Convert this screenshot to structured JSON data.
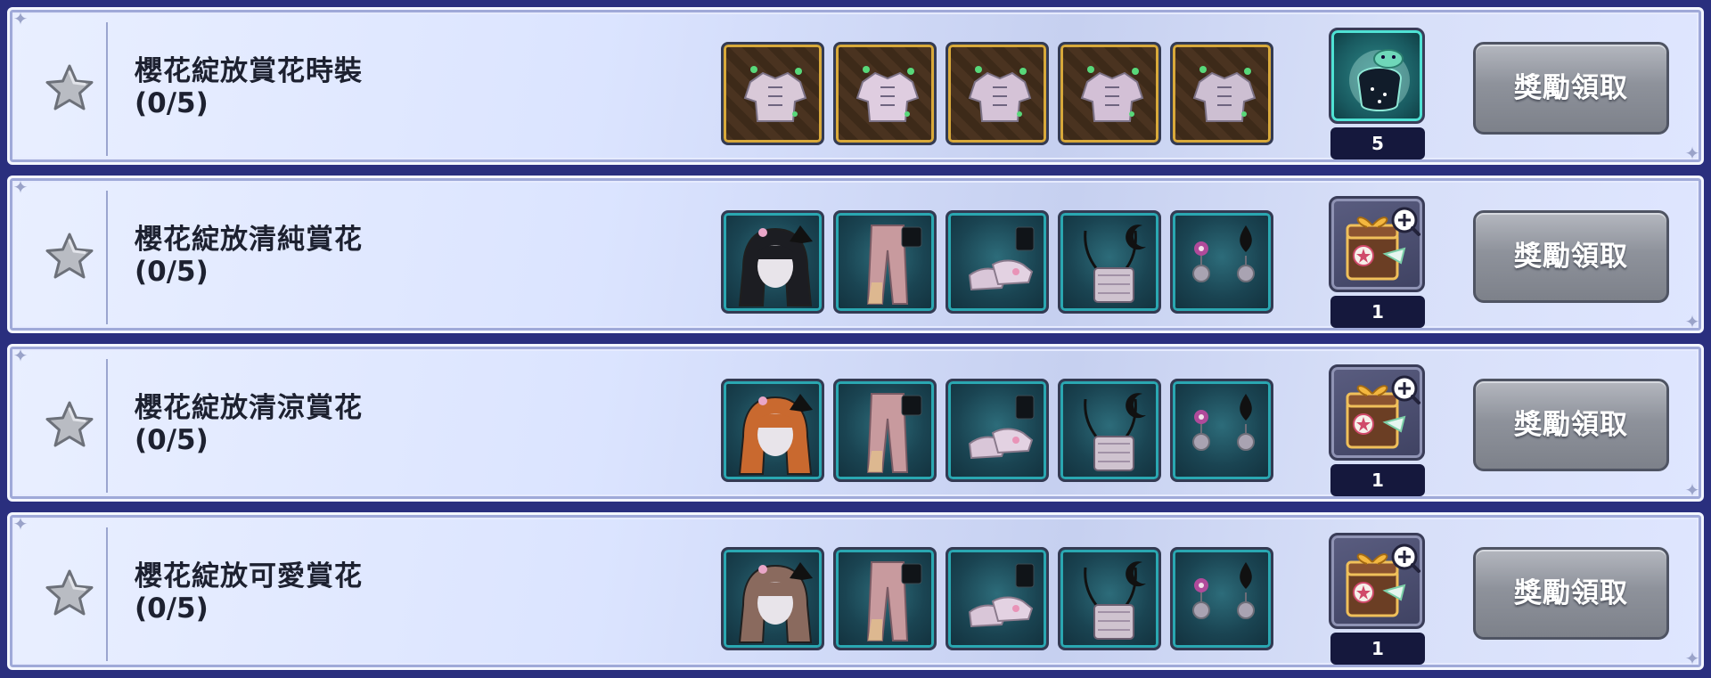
{
  "rows": [
    {
      "title": "櫻花綻放賞花時裝",
      "progress": "(0/5)",
      "items": [
        "top-outfit-1-icon",
        "top-outfit-2-icon",
        "top-outfit-3-icon",
        "top-outfit-4-icon",
        "top-outfit-5-icon"
      ],
      "item_style": "gold",
      "reward_icon": "teal-pouch-icon",
      "reward_count": "5",
      "claim_label": "獎勵領取"
    },
    {
      "title": "櫻花綻放清純賞花",
      "progress": "(0/5)",
      "items": [
        "black-hair-icon",
        "pants-icon",
        "shoes-icon",
        "handbag-icon",
        "earrings-icon"
      ],
      "item_style": "teal",
      "reward_icon": "gift-box-icon",
      "reward_count": "1",
      "claim_label": "獎勵領取"
    },
    {
      "title": "櫻花綻放清涼賞花",
      "progress": "(0/5)",
      "items": [
        "orange-hair-icon",
        "pants-icon",
        "shoes-icon",
        "handbag-icon",
        "earrings-icon"
      ],
      "item_style": "teal",
      "reward_icon": "gift-box-icon",
      "reward_count": "1",
      "claim_label": "獎勵領取"
    },
    {
      "title": "櫻花綻放可愛賞花",
      "progress": "(0/5)",
      "items": [
        "brown-hair-icon",
        "pants-icon",
        "shoes-icon",
        "handbag-icon",
        "earrings-icon"
      ],
      "item_style": "teal",
      "reward_icon": "gift-box-icon",
      "reward_count": "1",
      "claim_label": "獎勵領取"
    }
  ],
  "colors": {
    "panel_bg": "#dde5ff",
    "button_gray": "#8e929b",
    "count_bg": "#15183d",
    "item_teal": "#2aa7b1",
    "item_gold": "#d8a93a"
  }
}
